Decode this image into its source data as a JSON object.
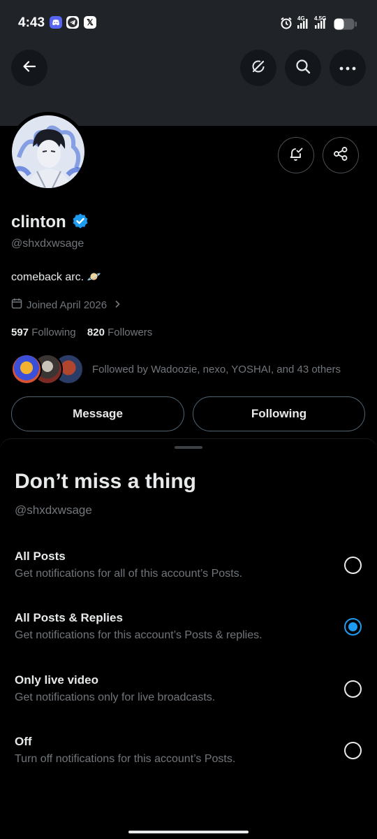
{
  "status_bar": {
    "time": "4:43",
    "network_1": "4G",
    "network_2": "4.5G"
  },
  "profile": {
    "name": "clinton",
    "handle": "@shxdxwsage",
    "bio": "comeback arc. 🪐",
    "joined": "Joined April 2026",
    "following_count": "597",
    "following_label": "Following",
    "followers_count": "820",
    "followers_label": "Followers",
    "followed_by": "Followed by Wadoozie, nexo, YOSHAI, and 43 others"
  },
  "buttons": {
    "message": "Message",
    "following": "Following"
  },
  "sheet": {
    "title": "Don’t miss a thing",
    "handle": "@shxdxwsage",
    "options": [
      {
        "label": "All Posts",
        "description": "Get notifications for all of this account’s Posts.",
        "selected": false
      },
      {
        "label": "All Posts & Replies",
        "description": "Get notifications for this account’s Posts & replies.",
        "selected": true
      },
      {
        "label": "Only live video",
        "description": "Get notifications only for live broadcasts.",
        "selected": false
      },
      {
        "label": "Off",
        "description": "Turn off notifications for this account’s Posts.",
        "selected": false
      }
    ]
  },
  "colors": {
    "accent": "#1d9bf0",
    "banner": "#202327",
    "background": "#000000",
    "muted_text": "#71767b"
  },
  "icons": [
    "back-arrow-icon",
    "grok-icon",
    "search-icon",
    "more-icon",
    "notification-bell-icon",
    "share-icon",
    "verified-badge-icon",
    "calendar-icon",
    "chevron-right-icon"
  ]
}
